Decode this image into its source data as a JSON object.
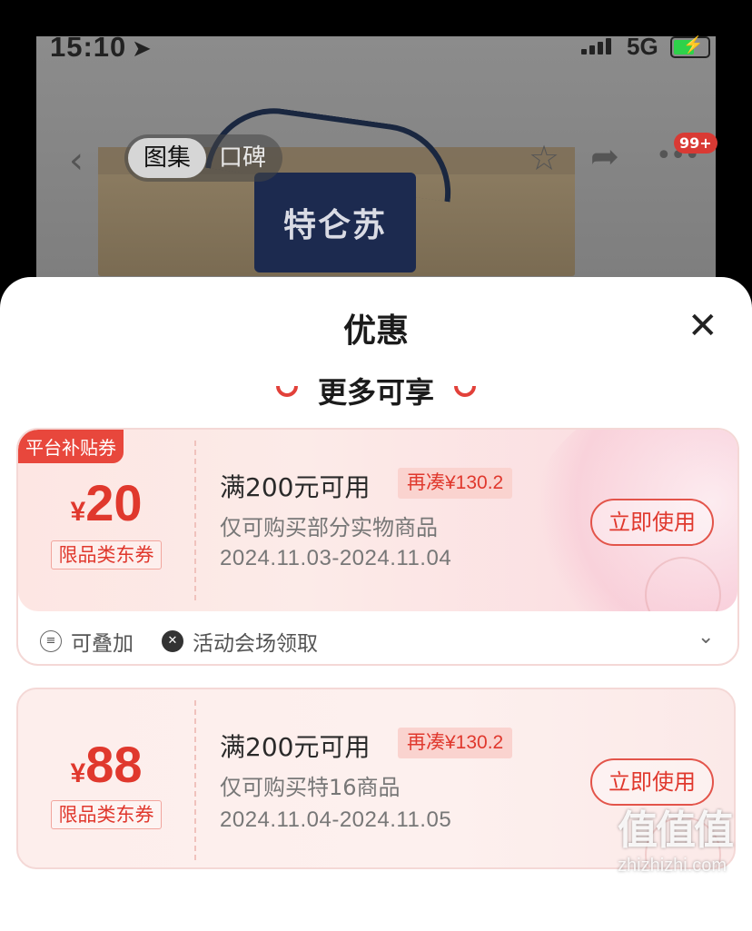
{
  "status_bar": {
    "time": "15:10",
    "network": "5G"
  },
  "product": {
    "brand_text": "特仑苏"
  },
  "nav": {
    "tabs": [
      "图集",
      "口碑"
    ],
    "active_tab": "图集",
    "notification_count": "99+"
  },
  "sheet": {
    "title": "优惠",
    "section_title": "更多可享"
  },
  "coupons": [
    {
      "platform_tag": "平台补贴券",
      "currency": "¥",
      "amount": "20",
      "limit_tag": "限品类东券",
      "condition": "满200元可用",
      "extra": "再凑¥130.2",
      "scope": "仅可购买部分实物商品",
      "dates": "2024.11.03-2024.11.04",
      "button": "立即使用",
      "footer": [
        "可叠加",
        "活动会场领取"
      ]
    },
    {
      "currency": "¥",
      "amount": "88",
      "limit_tag": "限品类东券",
      "condition": "满200元可用",
      "extra": "再凑¥130.2",
      "scope": "仅可购买特16商品",
      "dates": "2024.11.04-2024.11.05",
      "button": "立即使用"
    }
  ],
  "watermark": {
    "logo": "值值值",
    "site": "zhizhizhi.com"
  },
  "colors": {
    "accent": "#e0382d",
    "tag_bg": "#e8473c"
  }
}
